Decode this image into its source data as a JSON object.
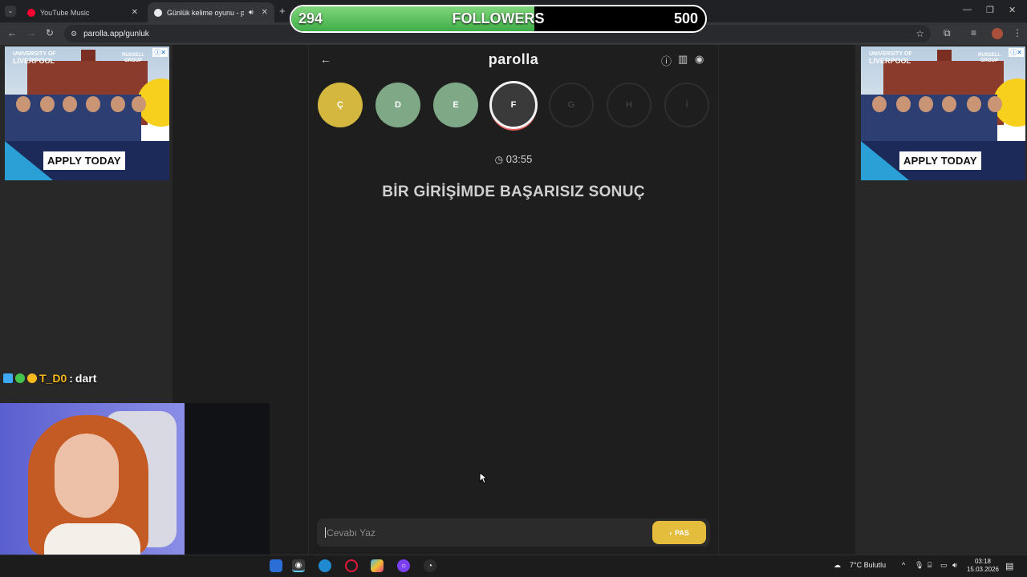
{
  "browser": {
    "tabs": [
      {
        "title": "YouTube Music",
        "favicon_color": "#ff0033",
        "active": false
      },
      {
        "title": "Günlük kelime oyunu - parolla",
        "favicon_color": "#e8eaed",
        "active": true
      }
    ],
    "url": "parolla.app/gunluk"
  },
  "followers_overlay": {
    "current": "294",
    "label": "FOLLOWERS",
    "goal": "500",
    "progress_fraction": 0.588
  },
  "ads": [
    {
      "cta": "APPLY TODAY",
      "university_line1": "UNIVERSITY OF",
      "university_line2": "LIVERPOOL",
      "group": "RUSSELL GROUP"
    },
    {
      "cta": "APPLY TODAY",
      "university_line1": "UNIVERSITY OF",
      "university_line2": "LIVERPOOL",
      "group": "RUSSELL GROUP"
    }
  ],
  "game": {
    "logo": "parolla",
    "letters": [
      {
        "char": "Ç",
        "state": "skipped",
        "color": "#d4b73e"
      },
      {
        "char": "D",
        "state": "correct",
        "color": "#7fa886"
      },
      {
        "char": "E",
        "state": "correct",
        "color": "#7fa886"
      },
      {
        "char": "F",
        "state": "current",
        "color": "#3a3a3a"
      },
      {
        "char": "G",
        "state": "pending",
        "color": "#1e1e1e"
      },
      {
        "char": "H",
        "state": "pending",
        "color": "#1e1e1e"
      },
      {
        "char": "İ",
        "state": "pending",
        "color": "#1e1e1e"
      }
    ],
    "timer": "03:55",
    "question": "BİR GİRİŞİMDE BAŞARISIZ SONUÇ",
    "answer_placeholder": "Cevabı Yaz",
    "pass_label": "PAS"
  },
  "chat": {
    "username": "T_D0",
    "separator": ":",
    "message": "dart"
  },
  "taskbar": {
    "weather": "7°C Bulutlu",
    "time": "03:18",
    "date": "15.03.2026"
  }
}
